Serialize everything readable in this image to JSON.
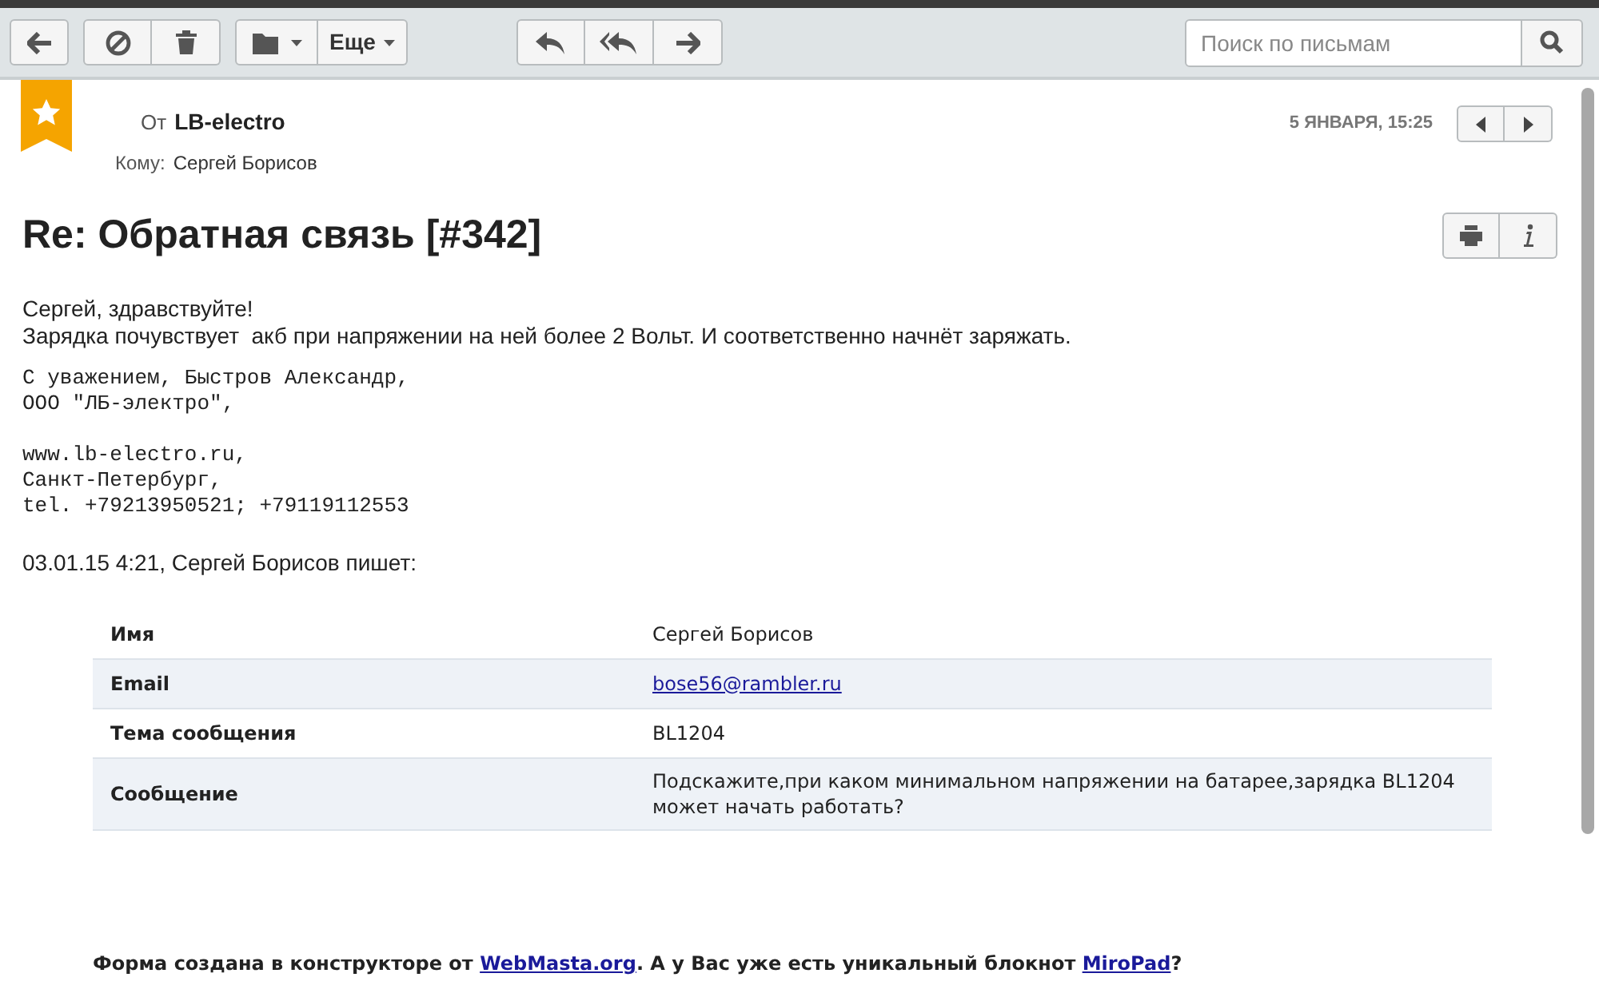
{
  "toolbar": {
    "more_label": "Еще",
    "search": {
      "placeholder": "Поиск по письмам"
    }
  },
  "message": {
    "starred": true,
    "from_label": "От",
    "from": "LB-electro",
    "to_label": "Кому:",
    "to": "Сергей Борисов",
    "date": "5 ЯНВАРЯ, 15:25",
    "subject": "Re: Обратная связь [#342]",
    "greeting": [
      "Сергей, здравствуйте!",
      "Зарядка почувствует  акб при напряжении на ней более 2 Вольт. И соответственно начнёт заряжать."
    ],
    "signature": [
      [
        "С уважением, Быстров Александр,",
        "ООО \"ЛБ-электро\","
      ],
      [
        "www.lb-electro.ru,",
        "Санкт-Петербург,",
        "tel. +79213950521; +79119112553"
      ]
    ],
    "quote_header": "03.01.15 4:21, Сергей Борисов пишет:",
    "form_rows": [
      {
        "label": "Имя",
        "value": "Сергей Борисов",
        "kind": "text"
      },
      {
        "label": "Email",
        "value": "bose56@rambler.ru",
        "kind": "link"
      },
      {
        "label": "Тема сообщения",
        "value": "BL1204",
        "kind": "text"
      },
      {
        "label": "Сообщение",
        "value": "Подскажите,при каком минимальном напряжении на батарее,зарядка BL1204 может начать работать?",
        "kind": "text"
      }
    ],
    "footer": [
      {
        "kind": "text",
        "text": "Форма создана в конструкторе от "
      },
      {
        "kind": "link",
        "text": "WebMasta.org"
      },
      {
        "kind": "text",
        "text": ". А у Вас уже есть уникальный блокнот "
      },
      {
        "kind": "link",
        "text": "MiroPad"
      },
      {
        "kind": "text",
        "text": "?"
      }
    ]
  }
}
